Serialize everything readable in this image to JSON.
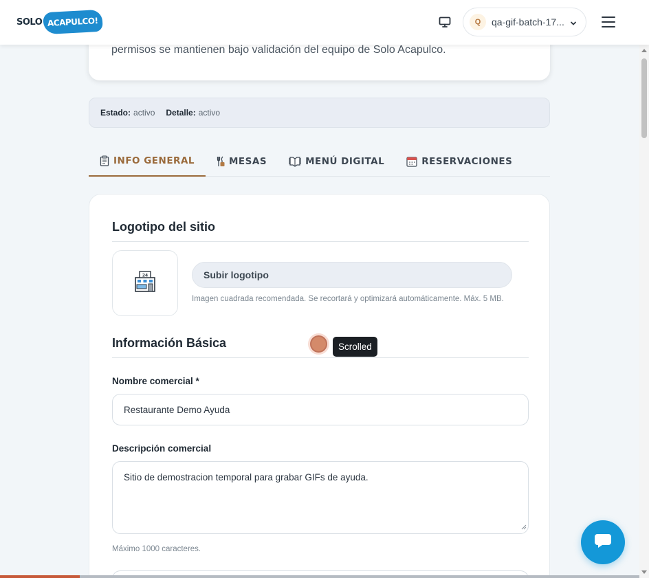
{
  "header": {
    "logo_solo": "SOLO",
    "logo_acapulco": "ACAPULCO!",
    "user_initial": "Q",
    "user_name": "qa-gif-batch-17..."
  },
  "intro": {
    "text": "permisos se mantienen bajo validación del equipo de Solo Acapulco."
  },
  "status": {
    "estado_label": "Estado:",
    "estado_value": "activo",
    "detalle_label": "Detalle:",
    "detalle_value": "activo"
  },
  "tabs": [
    {
      "label": "INFO GENERAL",
      "icon": "clipboard-icon",
      "active": true
    },
    {
      "label": "MESAS",
      "icon": "dining-icon",
      "active": false
    },
    {
      "label": "MENÚ DIGITAL",
      "icon": "menu-book-icon",
      "active": false
    },
    {
      "label": "RESERVACIONES",
      "icon": "calendar-icon",
      "active": false
    }
  ],
  "logo_section": {
    "title": "Logotipo del sitio",
    "upload_label": "Subir logotipo",
    "hint": "Imagen cuadrada recomendada. Se recortará y optimizará automáticamente. Máx. 5 MB.",
    "placeholder_icon": "store-icon"
  },
  "basic_section": {
    "title": "Información Básica",
    "name_label": "Nombre comercial *",
    "name_value": "Restaurante Demo Ayuda",
    "description_label": "Descripción comercial",
    "description_value": "Sitio de demostracion temporal para grabar GIFs de ayuda.",
    "description_hint": "Máximo 1000 caracteres."
  },
  "overlay": {
    "tooltip": "Scrolled"
  },
  "page_progress": 0.125,
  "colors": {
    "accent": "#9a6a3b",
    "chat_button": "#1498d8",
    "logo_blue": "#1e8ccf"
  }
}
